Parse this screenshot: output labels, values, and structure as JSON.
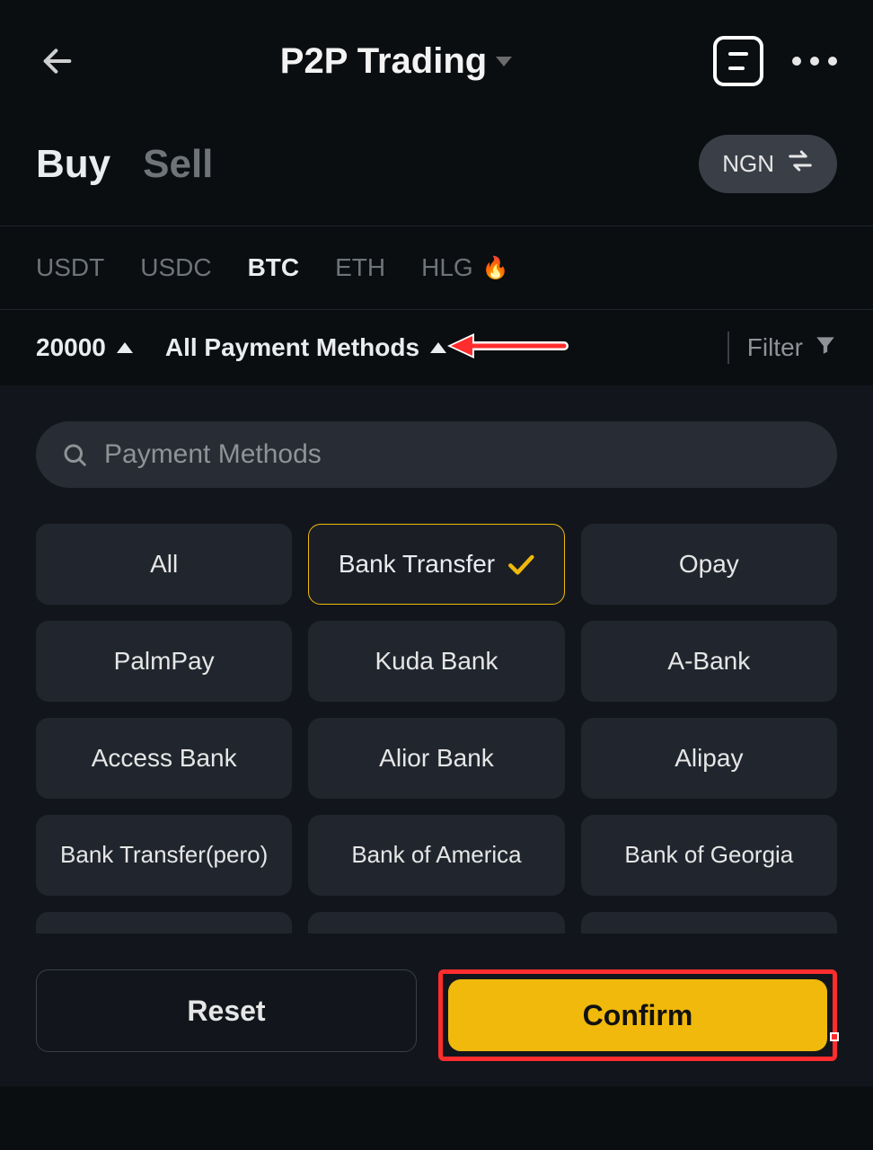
{
  "header": {
    "title": "P2P Trading"
  },
  "tabs": {
    "buy": "Buy",
    "sell": "Sell",
    "currency": "NGN"
  },
  "coins": {
    "items": [
      {
        "label": "USDT",
        "active": false
      },
      {
        "label": "USDC",
        "active": false
      },
      {
        "label": "BTC",
        "active": true
      },
      {
        "label": "ETH",
        "active": false
      },
      {
        "label": "HLG",
        "active": false,
        "hot": true
      }
    ]
  },
  "filterbar": {
    "amount": "20000",
    "method_label": "All Payment Methods",
    "filter_label": "Filter"
  },
  "search": {
    "placeholder": "Payment Methods"
  },
  "methods": {
    "items": [
      "All",
      "Bank Transfer",
      "Opay",
      "PalmPay",
      "Kuda Bank",
      "A-Bank",
      "Access Bank",
      "Alior Bank",
      "Alipay",
      "Bank Transfer(pero)",
      "Bank of America",
      "Bank of Georgia"
    ],
    "selected_index": 1
  },
  "buttons": {
    "reset": "Reset",
    "confirm": "Confirm"
  },
  "colors": {
    "accent": "#f0b90b",
    "annotation": "#ff2d2d"
  }
}
